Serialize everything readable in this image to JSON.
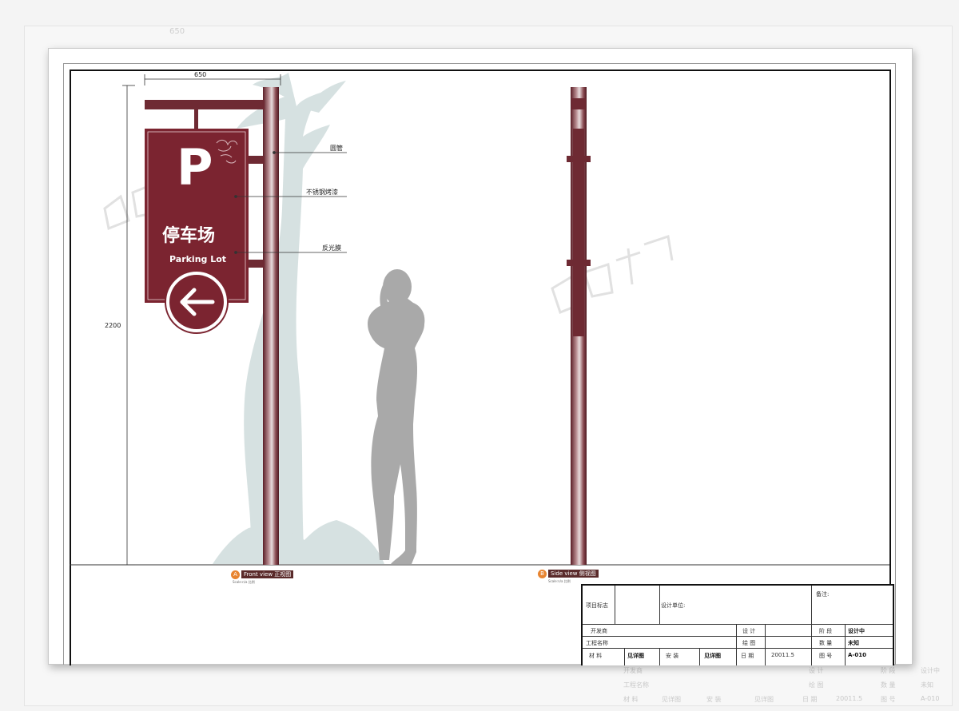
{
  "background_sheet": {
    "dimension": "650"
  },
  "front_view": {
    "dimension_width": "650",
    "dimension_height": "2200",
    "sign": {
      "letter": "P",
      "cn_text": "停车场",
      "en_text": "Parking Lot"
    },
    "callouts": [
      "圆管",
      "不锈钢烤漆",
      "反光膜"
    ],
    "view_tag_letter": "A",
    "view_label": "Front view 正视图",
    "scale_note": "Scale:n/a 比例"
  },
  "side_view": {
    "view_tag_letter": "B",
    "view_label": "Side view 侧视图",
    "scale_note": "Scale:n/a 比例"
  },
  "title_block": {
    "project_mark": "项目标志",
    "design_unit": "设计单位:",
    "remarks": "备注:",
    "developer": "开发商",
    "design": "设 计",
    "stage_label": "阶 段",
    "stage_value": "设计中",
    "project_name": "工程名称",
    "drawing": "绘 图",
    "quantity_label": "数 量",
    "quantity_value": "未知",
    "material_label": "材 料",
    "material_value": "见详图",
    "install_label": "安 装",
    "install_value": "见详图",
    "date_label": "日 期",
    "date_value": "20011.5",
    "drawing_no_label": "图 号",
    "drawing_no_value": "A-010"
  },
  "background_table": {
    "row1": [
      "开发商",
      "设 计",
      "阶 段",
      "设计中"
    ],
    "row2": [
      "工程名称",
      "绘 图",
      "数 量",
      "未知"
    ],
    "row3": [
      "材 料",
      "见详图",
      "安 装",
      "见详图",
      "日 期",
      "20011.5",
      "图 号",
      "A-010"
    ]
  },
  "colors": {
    "sign": "#7b2430",
    "pole": "#6e2a33",
    "silhouette": "#a9a9a9",
    "tree": "#cfdcdc",
    "tag": "#e88430"
  }
}
